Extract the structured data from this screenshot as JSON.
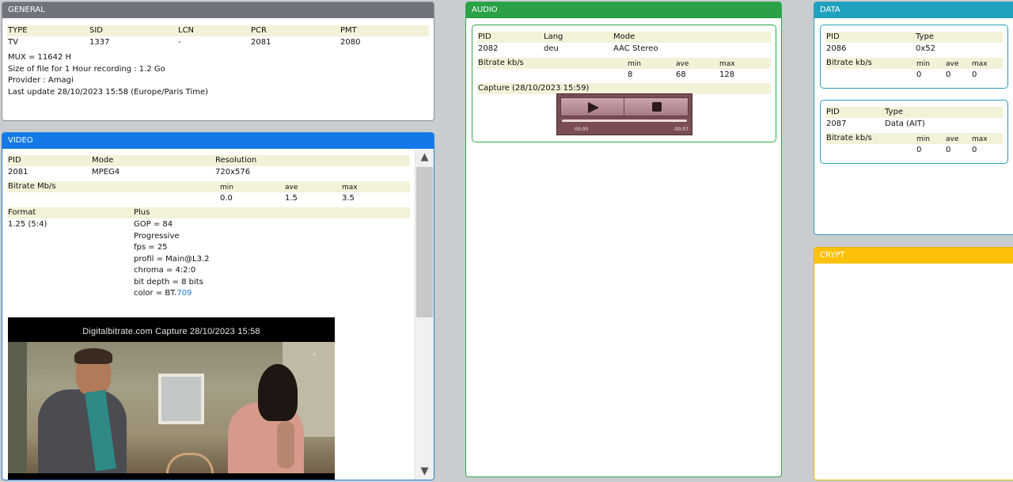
{
  "general": {
    "title": "GENERAL",
    "headers": [
      "TYPE",
      "SID",
      "LCN",
      "PCR",
      "PMT"
    ],
    "values": [
      "TV",
      "1337",
      "-",
      "2081",
      "2080"
    ],
    "lines": [
      "MUX = 11642 H",
      "Size of file for 1 Hour recording : 1.2 Go",
      "Provider : Amagi",
      "Last update 28/10/2023 15:58 (Europe/Paris Time)"
    ]
  },
  "video": {
    "title": "VIDEO",
    "headers": [
      "PID",
      "Mode",
      "Resolution"
    ],
    "values": [
      "2081",
      "MPEG4",
      "720x576"
    ],
    "bitrate_label": "Bitrate Mb/s",
    "stat_headers": [
      "min",
      "ave",
      "max"
    ],
    "stat_values": [
      "0.0",
      "1.5",
      "3.5"
    ],
    "format_label": "Format",
    "plus_label": "Plus",
    "format_value": "1.25 (5:4)",
    "plus_lines": [
      "GOP = 84",
      "Progressive",
      "fps = 25",
      "profil = Main@L3.2",
      "chroma = 4:2:0",
      "bit depth = 8 bits"
    ],
    "color_prefix": "color = BT.",
    "color_link": "709",
    "capture_caption": "Digitalbitrate.com Capture 28/10/2023 15:58",
    "scroll_up": "▲",
    "scroll_down": "▼"
  },
  "audio": {
    "title": "AUDIO",
    "headers": [
      "PID",
      "Lang",
      "Mode"
    ],
    "values": [
      "2082",
      "deu",
      "AAC Stereo"
    ],
    "bitrate_label": "Bitrate kb/s",
    "stat_headers": [
      "min",
      "ave",
      "max"
    ],
    "stat_values": [
      "8",
      "68",
      "128"
    ],
    "capture_label": "Capture (28/10/2023 15:59)",
    "player": {
      "time_start": "00:00",
      "time_end": "-00:07"
    }
  },
  "data": {
    "title": "DATA",
    "streams": [
      {
        "pid_label": "PID",
        "type_label": "Type",
        "pid": "2086",
        "type": "0x52",
        "bitrate_label": "Bitrate kb/s",
        "stat_headers": [
          "min",
          "ave",
          "max"
        ],
        "stat_values": [
          "0",
          "0",
          "0"
        ]
      },
      {
        "pid_label": "PID",
        "type_label": "Type",
        "pid": "2087",
        "type": "Data (AIT)",
        "bitrate_label": "Bitrate kb/s",
        "stat_headers": [
          "min",
          "ave",
          "max"
        ],
        "stat_values": [
          "0",
          "0",
          "0"
        ]
      }
    ]
  },
  "crypt": {
    "title": "CRYPT"
  },
  "colors": {
    "general_header": "#6e7479",
    "video_header": "#1379e6",
    "audio_header": "#2aa147",
    "data_header": "#1ea2bd",
    "crypt_header": "#ffc107",
    "row_highlight": "#f3f1d8",
    "link": "#1e7ad6"
  }
}
